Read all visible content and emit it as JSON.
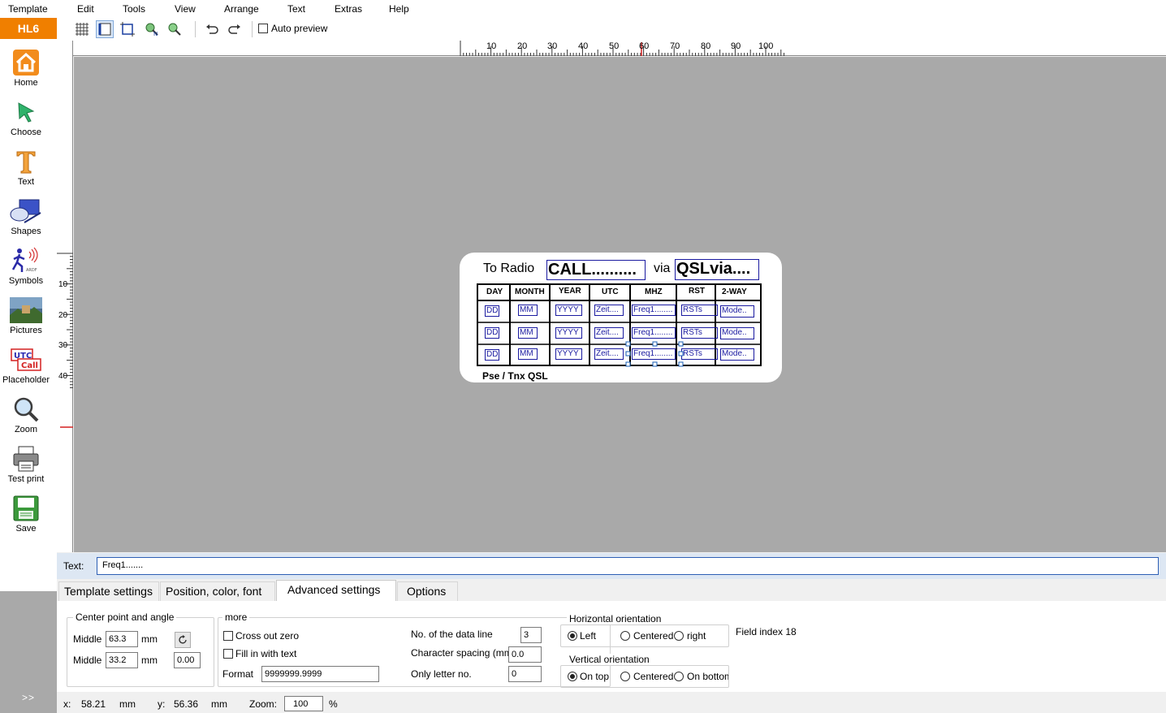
{
  "menu": [
    "Template",
    "Edit",
    "Tools",
    "View",
    "Arrange",
    "Text",
    "Extras",
    "Help"
  ],
  "toolbar": {
    "auto_preview": "Auto preview"
  },
  "brand": "HL6",
  "sidebar": [
    {
      "label": "Home",
      "icon": "home-icon"
    },
    {
      "label": "Choose",
      "icon": "cursor-arrow-icon"
    },
    {
      "label": "Text",
      "icon": "text-t-icon"
    },
    {
      "label": "Shapes",
      "icon": "shapes-icon"
    },
    {
      "label": "Symbols",
      "icon": "ardf-runner-icon"
    },
    {
      "label": "Pictures",
      "icon": "picture-landscape-icon"
    },
    {
      "label": "Placeholder",
      "icon": "utc-call-placeholder-icon"
    },
    {
      "label": "Zoom",
      "icon": "magnifier-icon"
    },
    {
      "label": "Test print",
      "icon": "printer-icon"
    },
    {
      "label": "Save",
      "icon": "save-disk-icon"
    }
  ],
  "expand_label": ">>",
  "ruler": {
    "top_labels": [
      "10",
      "20",
      "30",
      "40",
      "50",
      "60",
      "70",
      "80",
      "90",
      "100"
    ],
    "left_labels": [
      "10",
      "20",
      "30",
      "40"
    ]
  },
  "card": {
    "to_radio": "To Radio",
    "call": "CALL..........",
    "via": "via",
    "qslvia": "QSLvia....",
    "headers": [
      "DAY",
      "MONTH",
      "YEAR",
      "UTC",
      "MHZ",
      "RST",
      "2-WAY"
    ],
    "rows": [
      [
        "DD",
        "MM",
        "YYYY",
        "Zeit....",
        "Freq1........",
        "RSTs",
        "Mode.."
      ],
      [
        "DD",
        "MM",
        "YYYY",
        "Zeit....",
        "Freq1........",
        "RSTs",
        "Mode.."
      ],
      [
        "DD",
        "MM",
        "YYYY",
        "Zeit....",
        "Freq1........",
        "RSTs",
        "Mode.."
      ]
    ],
    "footer": "Pse / Tnx  QSL"
  },
  "text_field": {
    "label": "Text:",
    "value": "Freq1......."
  },
  "tabs": [
    "Template settings",
    "Position, color, font",
    "Advanced settings",
    "Options"
  ],
  "active_tab": "Advanced settings",
  "center": {
    "title": "Center point and angle",
    "middle1_label": "Middle",
    "middle1_value": "63.3",
    "unit1": "mm",
    "middle2_label": "Middle",
    "middle2_value": "33.2",
    "unit2": "mm",
    "angle_value": "0.00"
  },
  "more": {
    "title": "more",
    "cross_out_zero": "Cross out zero",
    "fill_in_text": "Fill in with text",
    "format_label": "Format",
    "format_value": "9999999.9999",
    "data_line_label": "No. of the data line",
    "data_line_value": "3",
    "char_spacing_label": "Character spacing (mm",
    "char_spacing_value": "0.0",
    "only_letter_label": "Only letter no.",
    "only_letter_value": "0"
  },
  "horizontal": {
    "title": "Horizontal orientation",
    "options": [
      "Left",
      "Centered",
      "right"
    ],
    "selected": "Left"
  },
  "vertical": {
    "title": "Vertical orientation",
    "options": [
      "On top",
      "Centered",
      "On bottom"
    ],
    "selected": "On top"
  },
  "field_index": "Field index 18",
  "status": {
    "x_label": "x:",
    "x_value": "58.21",
    "x_unit": "mm",
    "y_label": "y:",
    "y_value": "56.36",
    "y_unit": "mm",
    "zoom_label": "Zoom:",
    "zoom_value": "100",
    "zoom_unit": "%"
  },
  "colors": {
    "brand": "#f07f00",
    "canvas": "#a9a9a9",
    "field_border": "#1a1aa0"
  }
}
